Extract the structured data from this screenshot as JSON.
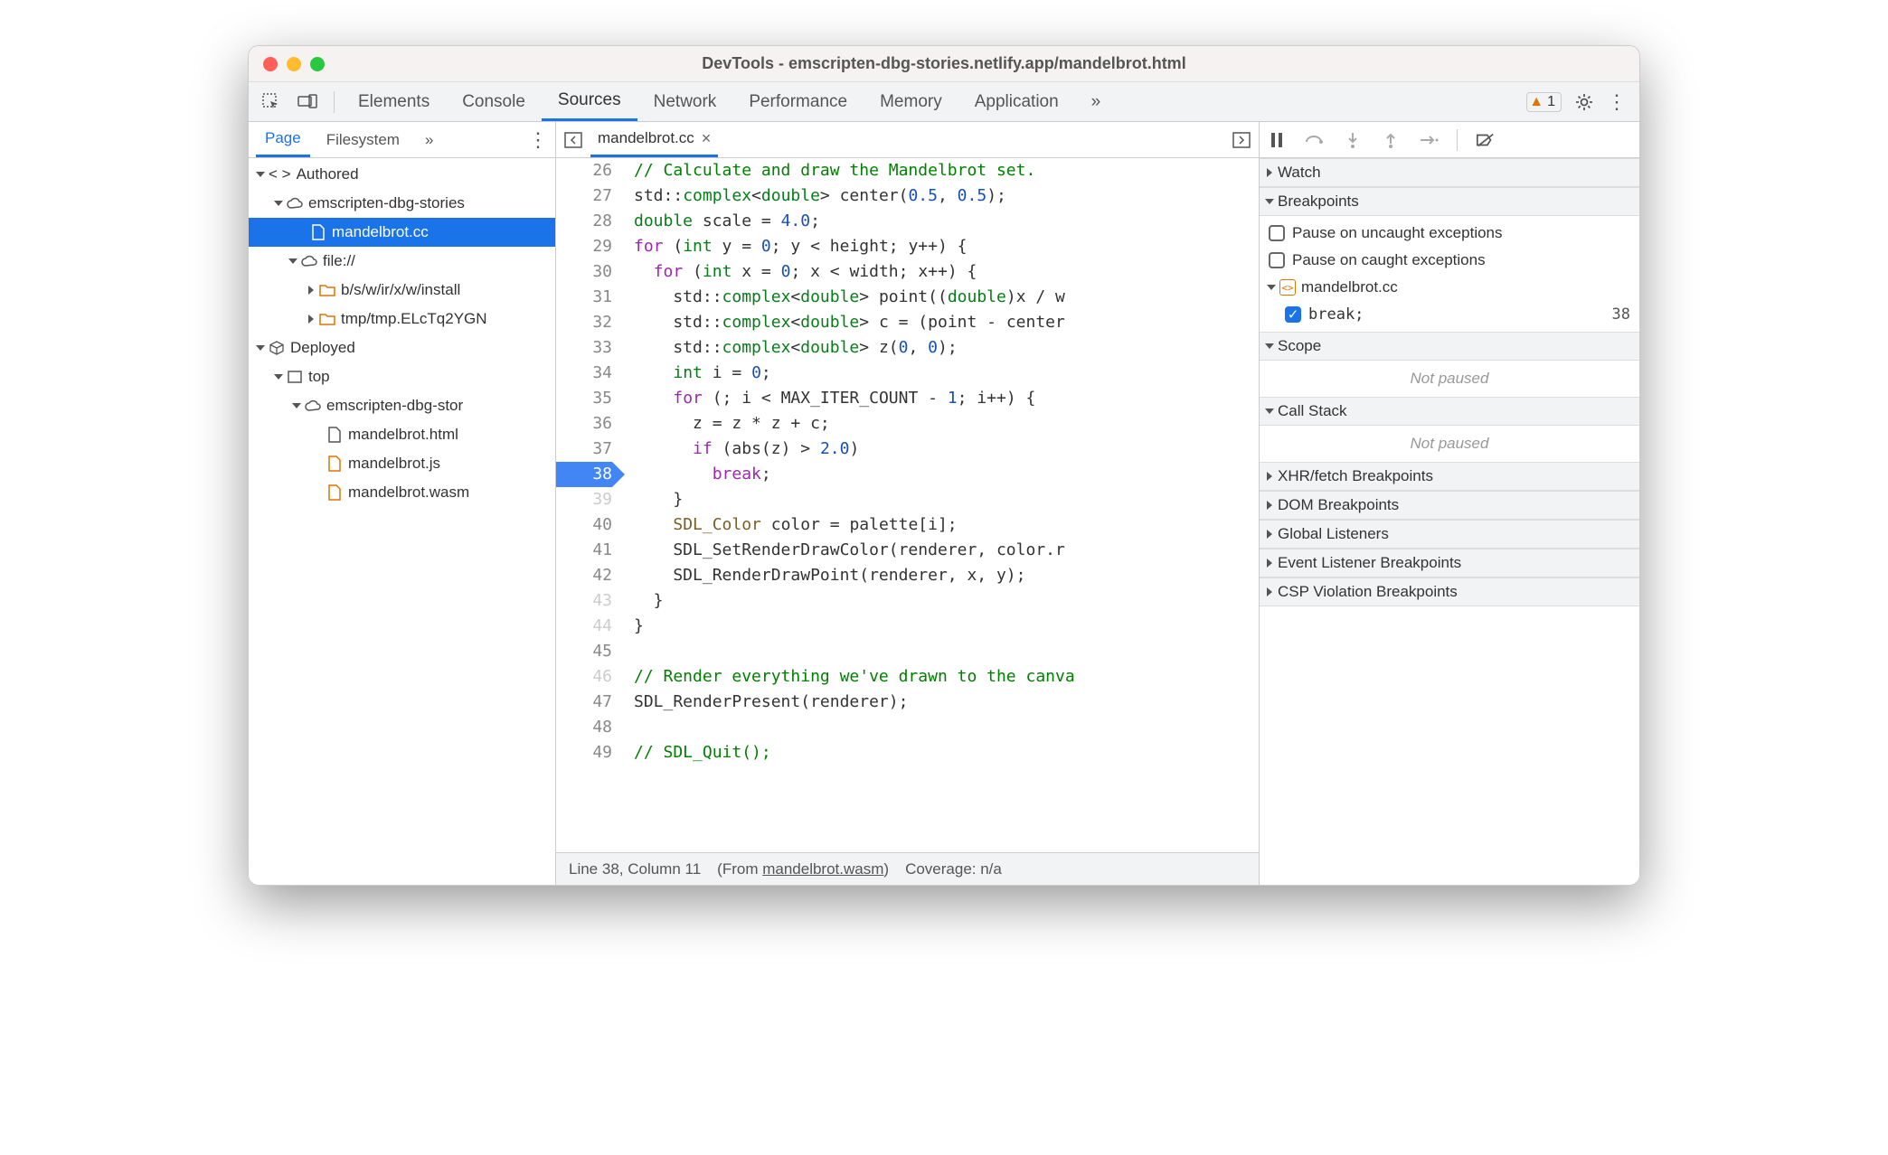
{
  "window": {
    "title": "DevTools - emscripten-dbg-stories.netlify.app/mandelbrot.html"
  },
  "toolbar": {
    "tabs": [
      "Elements",
      "Console",
      "Sources",
      "Network",
      "Performance",
      "Memory",
      "Application"
    ],
    "active_tab": "Sources",
    "warn_count": "1"
  },
  "sidebar": {
    "tabs": [
      "Page",
      "Filesystem"
    ],
    "active": "Page",
    "tree": {
      "authored": "Authored",
      "authored_domain": "emscripten-dbg-stories",
      "selected_file": "mandelbrot.cc",
      "file_scheme": "file://",
      "folder1": "b/s/w/ir/x/w/install",
      "folder2": "tmp/tmp.ELcTq2YGN",
      "deployed": "Deployed",
      "top": "top",
      "deployed_domain": "emscripten-dbg-stor",
      "files": [
        "mandelbrot.html",
        "mandelbrot.js",
        "mandelbrot.wasm"
      ]
    }
  },
  "editor": {
    "tab_name": "mandelbrot.cc",
    "lines_start": 26,
    "breakpoint_line": 38,
    "code": [
      {
        "n": 26,
        "h": "<span class='c-cm'>// Calculate and draw the Mandelbrot set.</span>"
      },
      {
        "n": 27,
        "h": "std::<span class='c-ty'>complex</span>&lt;<span class='c-ty'>double</span>&gt; center(<span class='c-nm'>0.5</span>, <span class='c-nm'>0.5</span>);"
      },
      {
        "n": 28,
        "h": "<span class='c-ty'>double</span> scale = <span class='c-nm'>4.0</span>;"
      },
      {
        "n": 29,
        "h": "<span class='c-kw'>for</span> (<span class='c-ty'>int</span> y = <span class='c-nm'>0</span>; y &lt; height; y++) {"
      },
      {
        "n": 30,
        "h": "  <span class='c-kw'>for</span> (<span class='c-ty'>int</span> x = <span class='c-nm'>0</span>; x &lt; width; x++) {"
      },
      {
        "n": 31,
        "h": "    std::<span class='c-ty'>complex</span>&lt;<span class='c-ty'>double</span>&gt; point((<span class='c-ty'>double</span>)x / w"
      },
      {
        "n": 32,
        "h": "    std::<span class='c-ty'>complex</span>&lt;<span class='c-ty'>double</span>&gt; c = (point - center"
      },
      {
        "n": 33,
        "h": "    std::<span class='c-ty'>complex</span>&lt;<span class='c-ty'>double</span>&gt; z(<span class='c-nm'>0</span>, <span class='c-nm'>0</span>);"
      },
      {
        "n": 34,
        "h": "    <span class='c-ty'>int</span> i = <span class='c-nm'>0</span>;"
      },
      {
        "n": 35,
        "h": "    <span class='c-kw'>for</span> (; i &lt; MAX_ITER_COUNT - <span class='c-nm'>1</span>; i++) {"
      },
      {
        "n": 36,
        "h": "      z = z * z + c;"
      },
      {
        "n": 37,
        "h": "      <span class='c-kw'>if</span> (abs(z) &gt; <span class='c-nm'>2.0</span>)"
      },
      {
        "n": 38,
        "h": "        <span class='c-kw'>break</span>;"
      },
      {
        "n": 39,
        "h": "    }",
        "dim": true
      },
      {
        "n": 40,
        "h": "    <span class='c-fn'>SDL_Color</span> color = palette[i];"
      },
      {
        "n": 41,
        "h": "    SDL_SetRenderDrawColor(renderer, color.r"
      },
      {
        "n": 42,
        "h": "    SDL_RenderDrawPoint(renderer, x, y);"
      },
      {
        "n": 43,
        "h": "  }",
        "dim": true
      },
      {
        "n": 44,
        "h": "}",
        "dim": true
      },
      {
        "n": 45,
        "h": ""
      },
      {
        "n": 46,
        "h": "<span class='c-cm'>// Render everything we've drawn to the canva</span>",
        "dim": true
      },
      {
        "n": 47,
        "h": "SDL_RenderPresent(renderer);"
      },
      {
        "n": 48,
        "h": ""
      },
      {
        "n": 49,
        "h": "<span class='c-cm'>// SDL_Quit();</span>"
      }
    ],
    "status": {
      "pos": "Line 38, Column 11",
      "from_label": "(From ",
      "from_file": "mandelbrot.wasm",
      "from_close": ")",
      "coverage": "Coverage: n/a"
    }
  },
  "right": {
    "watch": "Watch",
    "breakpoints": "Breakpoints",
    "pause_uncaught": "Pause on uncaught exceptions",
    "pause_caught": "Pause on caught exceptions",
    "bp_file": "mandelbrot.cc",
    "bp_code": "break;",
    "bp_line": "38",
    "scope": "Scope",
    "not_paused": "Not paused",
    "callstack": "Call Stack",
    "xhr": "XHR/fetch Breakpoints",
    "dom": "DOM Breakpoints",
    "global": "Global Listeners",
    "evt": "Event Listener Breakpoints",
    "csp": "CSP Violation Breakpoints"
  }
}
